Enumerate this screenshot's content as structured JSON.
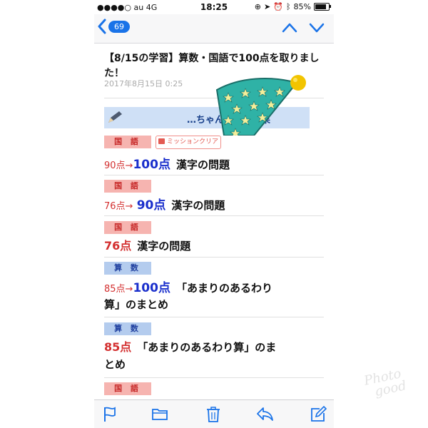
{
  "status_bar": {
    "carrier": "●●●●○ au  4G",
    "time": "18:25",
    "battery": "85%",
    "battery_level": 0.85
  },
  "nav": {
    "back_count": "69"
  },
  "mail": {
    "subject": "【8/15の学習】算数・国語で100点を取りました！",
    "date": "2017年8月15日 0:25"
  },
  "banner": {
    "title": "…ちゃんの学習結果"
  },
  "mission_label": "ミッションクリア",
  "entries": [
    {
      "subject": "国 語",
      "old_score": "90点",
      "arrow": "→",
      "new_score": "100点",
      "text": "漢字の問題"
    },
    {
      "subject": "国 語",
      "old_score": "76点",
      "arrow": "→",
      "new_score": "90点",
      "text": "漢字の問題"
    },
    {
      "subject": "国 語",
      "score": "76点",
      "text": "漢字の問題"
    },
    {
      "subject": "算 数",
      "old_score": "85点",
      "arrow": "→",
      "new_score": "100点",
      "text_line1": "「あまりのあるわり",
      "text_line2": "算」のまとめ"
    },
    {
      "subject": "算 数",
      "score": "85点",
      "text_line1": "「あまりのあるわり算」のま",
      "text_line2": "とめ"
    },
    {
      "subject": "国 語"
    }
  ],
  "toolbar": {
    "icons": [
      "flag-icon",
      "folder-icon",
      "trash-icon",
      "reply-icon",
      "compose-icon"
    ]
  },
  "colors": {
    "accent": "#1a73e8",
    "red": "#d32f2f",
    "blue": "#1a2fcc",
    "banner": "#cfe0f6"
  }
}
